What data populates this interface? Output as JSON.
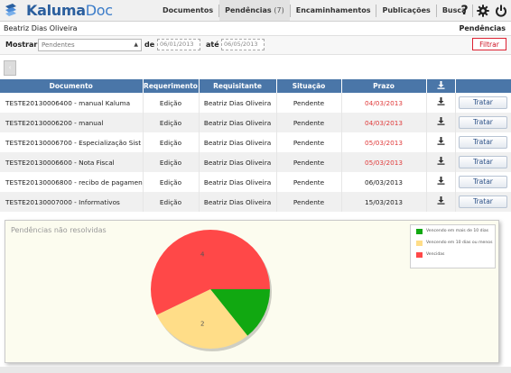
{
  "app": {
    "name_part1": "Kaluma",
    "name_part2": "Doc"
  },
  "nav": {
    "documentos": "Documentos",
    "pendencias": "Pendências",
    "pendencias_count": "(7)",
    "encaminhamentos": "Encaminhamentos",
    "publicacoes": "Publicações",
    "busca": "Busca"
  },
  "icons": {
    "help": "help-icon",
    "settings": "gear-icon",
    "power": "power-icon"
  },
  "user": {
    "name": "Beatriz Dias Oliveira"
  },
  "page": {
    "title": "Pendências"
  },
  "filter": {
    "mostrar_label": "Mostrar",
    "mostrar_value": "Pendentes",
    "de_label": "de",
    "de_value": "06/01/2013",
    "ate_label": "até",
    "ate_value": "06/05/2013",
    "button": "Filtrar"
  },
  "table": {
    "headers": [
      "Documento",
      "Requerimento",
      "Requisitante",
      "Situação",
      "Prazo",
      ""
    ],
    "rows": [
      {
        "documento": "TESTE20130006400 - manual Kaluma",
        "requerimento": "Edição",
        "requisitante": "Beatriz Dias Oliveira",
        "situacao": "Pendente",
        "prazo": "04/03/2013",
        "late": true,
        "action": "Tratar"
      },
      {
        "documento": "TESTE20130006200 - manual",
        "requerimento": "Edição",
        "requisitante": "Beatriz Dias Oliveira",
        "situacao": "Pendente",
        "prazo": "04/03/2013",
        "late": true,
        "action": "Tratar"
      },
      {
        "documento": "TESTE20130006700 - Especialização Sist",
        "requerimento": "Edição",
        "requisitante": "Beatriz Dias Oliveira",
        "situacao": "Pendente",
        "prazo": "05/03/2013",
        "late": true,
        "action": "Tratar"
      },
      {
        "documento": "TESTE20130006600 - Nota Fiscal",
        "requerimento": "Edição",
        "requisitante": "Beatriz Dias Oliveira",
        "situacao": "Pendente",
        "prazo": "05/03/2013",
        "late": true,
        "action": "Tratar"
      },
      {
        "documento": "TESTE20130006800 - recibo de pagamen",
        "requerimento": "Edição",
        "requisitante": "Beatriz Dias Oliveira",
        "situacao": "Pendente",
        "prazo": "06/03/2013",
        "late": false,
        "action": "Tratar"
      },
      {
        "documento": "TESTE20130007000 - Informativos",
        "requerimento": "Edição",
        "requisitante": "Beatriz Dias Oliveira",
        "situacao": "Pendente",
        "prazo": "15/03/2013",
        "late": false,
        "action": "Tratar"
      }
    ]
  },
  "chart_data": {
    "type": "pie",
    "title": "Pendências não resolvidas",
    "legend_position": "top-right",
    "slices": [
      {
        "label": "Vencendo em mais de 10 dias",
        "value": 1,
        "color": "#11a811"
      },
      {
        "label": "Vencendo em 10 dias ou menos",
        "value": 2,
        "color": "#ffdd88"
      },
      {
        "label": "Vencidas",
        "value": 4,
        "color": "#ff4848"
      }
    ],
    "data_labels": [
      "",
      "2",
      "4"
    ]
  },
  "colors": {
    "header_blue": "#4a76a8",
    "late_red": "#e03b3b",
    "filter_red": "#cc1122"
  }
}
